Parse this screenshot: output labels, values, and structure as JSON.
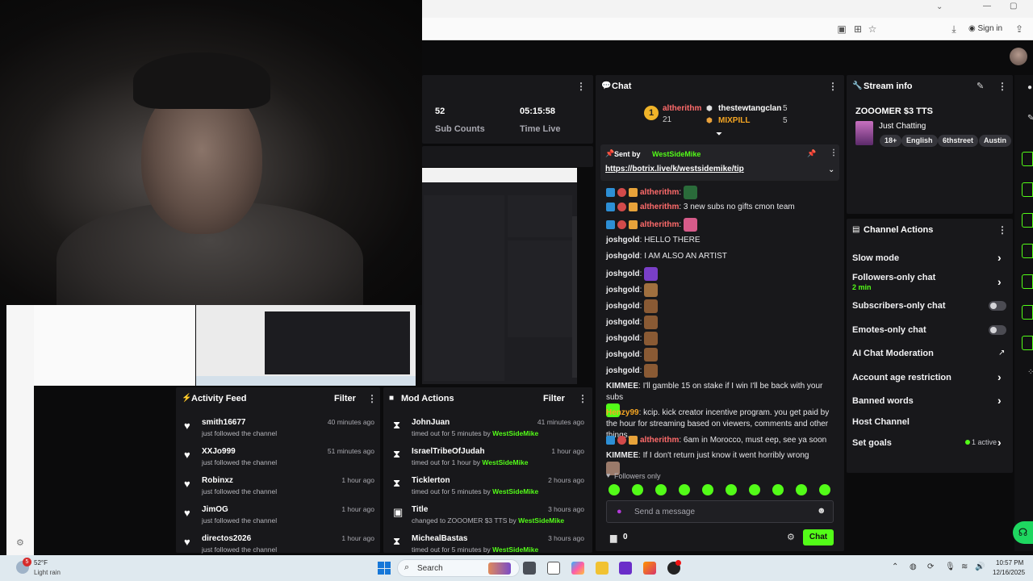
{
  "browser": {
    "signin_label": "Sign in"
  },
  "stats": {
    "sub_count": "52",
    "sub_count_label": "Sub Counts",
    "time_live": "05:15:58",
    "time_live_label": "Time Live"
  },
  "chat": {
    "title": "Chat",
    "leaderboard": [
      {
        "rank": "1",
        "name": "altherithm",
        "count": "21"
      },
      {
        "name": "thestewtangclan",
        "count": "5"
      },
      {
        "name": "MIXPILL",
        "count": "5"
      }
    ],
    "pinned": {
      "sent_by_label": "Sent by",
      "sender": "WestSideMike",
      "link": "https://botrix.live/k/westsidemike/tip"
    },
    "messages": [
      {
        "user": "altherithm",
        "text": "",
        "color": "#ff6b6b"
      },
      {
        "user": "altherithm",
        "text": "3 new subs no gifts cmon team",
        "color": "#ff6b6b"
      },
      {
        "user": "altherithm",
        "text": "",
        "color": "#ff6b6b"
      },
      {
        "user": "joshgold",
        "text": "HELLO THERE",
        "color": "#e8e8ea"
      },
      {
        "user": "joshgold",
        "text": "I AM ALSO AN ARTIST",
        "color": "#e8e8ea"
      },
      {
        "user": "joshgold",
        "text": "",
        "color": "#e8e8ea"
      },
      {
        "user": "joshgold",
        "text": "",
        "color": "#e8e8ea"
      },
      {
        "user": "joshgold",
        "text": "",
        "color": "#e8e8ea"
      },
      {
        "user": "joshgold",
        "text": "",
        "color": "#e8e8ea"
      },
      {
        "user": "joshgold",
        "text": "",
        "color": "#e8e8ea"
      },
      {
        "user": "joshgold",
        "text": "",
        "color": "#e8e8ea"
      },
      {
        "user": "joshgold",
        "text": "",
        "color": "#e8e8ea"
      },
      {
        "user": "KIMMEE",
        "text": "I'll gamble 15 on stake if I win I'll be back with your subs",
        "color": "#e8e8ea"
      },
      {
        "user": "Henzy99",
        "text": "kcip. kick creator incentive program. you get paid by the hour for streaming based on viewers, comments and other things.",
        "color": "#f5a623"
      },
      {
        "user": "altherithm",
        "text": "6am in Morocco, must eep, see ya soon",
        "color": "#ff6b6b"
      },
      {
        "user": "KIMMEE",
        "text": "If I don't return just know it went horribly wrong",
        "color": "#e8e8ea"
      }
    ],
    "followers_only": "Followers only",
    "input_placeholder": "Send a message",
    "points": "0",
    "send_label": "Chat"
  },
  "stream_info": {
    "title": "Stream info",
    "stream_title": "ZOOOMER $3 TTS",
    "category": "Just Chatting",
    "tags": [
      "18+",
      "English",
      "6thstreet",
      "Austin"
    ]
  },
  "channel_actions": {
    "title": "Channel Actions",
    "items": [
      {
        "label": "Slow mode"
      },
      {
        "label": "Followers-only chat",
        "sub": "2 min"
      },
      {
        "label": "Subscribers-only chat"
      },
      {
        "label": "Emotes-only chat"
      },
      {
        "label": "AI Chat Moderation"
      },
      {
        "label": "Account age restriction"
      },
      {
        "label": "Banned words"
      },
      {
        "label": "Host Channel"
      },
      {
        "label": "Set goals",
        "status": "1 active"
      }
    ]
  },
  "activity_feed": {
    "title": "Activity Feed",
    "filter_label": "Filter",
    "items": [
      {
        "name": "smith16677",
        "sub": "just followed the channel",
        "time": "40 minutes ago"
      },
      {
        "name": "XXJo999",
        "sub": "just followed the channel",
        "time": "51 minutes ago"
      },
      {
        "name": "Robinxz",
        "sub": "just followed the channel",
        "time": "1 hour ago"
      },
      {
        "name": "JimOG",
        "sub": "just followed the channel",
        "time": "1 hour ago"
      },
      {
        "name": "directos2026",
        "sub": "just followed the channel",
        "time": "1 hour ago"
      }
    ]
  },
  "mod_actions": {
    "title": "Mod Actions",
    "filter_label": "Filter",
    "items": [
      {
        "name": "JohnJuan",
        "sub": "timed out for 5 minutes by",
        "by": "WestSideMike",
        "time": "41 minutes ago"
      },
      {
        "name": "IsraelTribeOfJudah",
        "sub": "timed out for 1 hour by",
        "by": "WestSideMike",
        "time": "1 hour ago"
      },
      {
        "name": "Ticklerton",
        "sub": "timed out for 5 minutes by",
        "by": "WestSideMike",
        "time": "2 hours ago"
      },
      {
        "name": "Title",
        "sub": "changed to ZOOOMER $3 TTS by",
        "by": "WestSideMike",
        "time": "3 hours ago"
      },
      {
        "name": "MichealBastas",
        "sub": "timed out for 5 minutes by",
        "by": "WestSideMike",
        "time": "3 hours ago"
      }
    ]
  },
  "taskbar": {
    "weather_temp": "52°F",
    "weather_desc": "Light rain",
    "search_label": "Search",
    "clock_time": "10:57 PM",
    "clock_date": "12/16/2025",
    "notif_count": "5"
  },
  "colors": {
    "accent": "#53fc18",
    "panel": "#18181b",
    "bg": "#0b0b0c"
  }
}
